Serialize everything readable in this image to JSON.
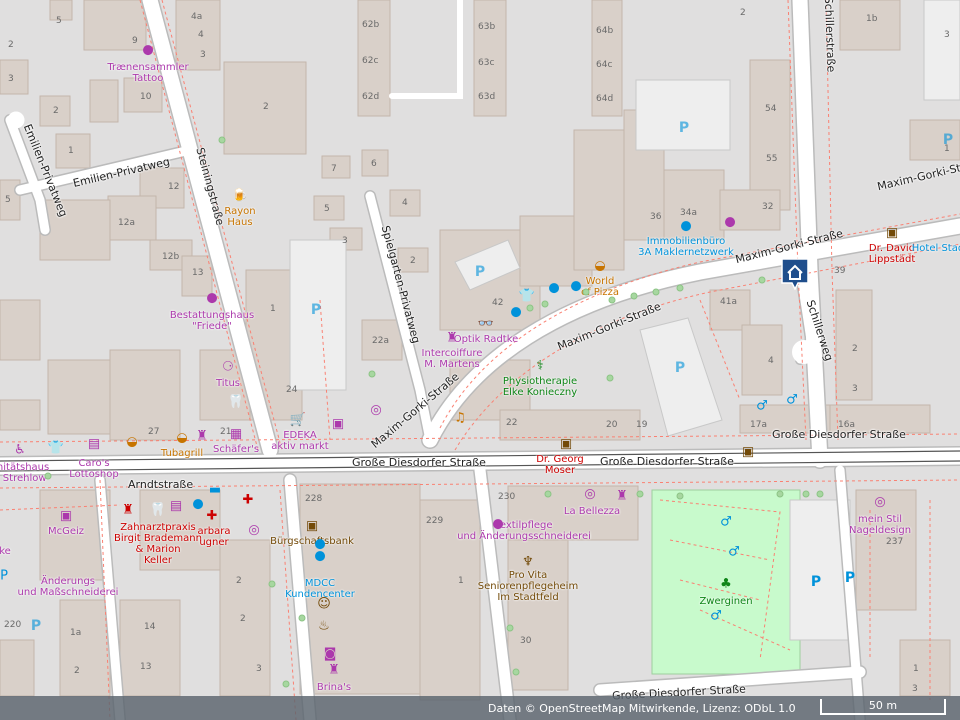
{
  "attribution": "Daten © OpenStreetMap Mitwirkende, Lizenz: ODbL 1.0",
  "scale_label": "50 m",
  "marker_icon": "home-icon",
  "streets": {
    "grosse_diesdorfer_1": "Große Diesdorfer Straße",
    "grosse_diesdorfer_2": "Große Diesdorfer Straße",
    "grosse_diesdorfer_3": "Große Diesdorfer Straße",
    "grosse_diesdorfer_4": "Große Diesdorfer Straße",
    "maxim_1": "Maxim-Gorki-Straße",
    "maxim_2": "Maxim-Gorki-Straße",
    "maxim_3": "Maxim-Gorki-Straße",
    "maxim_4": "Maxim-Gorki-Straße",
    "steiningstrasse": "Steiningstraße",
    "spielgarten": "Spielgarten-Privatweg",
    "emilien_h": "Emilien-Privatweg",
    "emilien_v": "Emilien-Privatweg",
    "schillerstrasse": "Schillerstraße",
    "schillerweg": "Schillerweg",
    "arndtstrasse": "Arndtstraße",
    "bottom_street": "Große Diesdorfer Straße"
  },
  "pois": {
    "tattoo": "Trænensammler\nTattoo",
    "rayon": "Rayon\nHaus",
    "bestattung": "Bestattungshaus\n\"Friede\"",
    "titus": "Titus",
    "edeka": "EDEKA\naktiv markt",
    "schafers": "Schäfer's",
    "tubagrill": "Tubagrill",
    "caros": "Caro's\nLottoshop",
    "sanitaet": "anitätshaus\ne Strehlow",
    "optik": "Optik Radtke",
    "intercoiffure": "Intercoiffure\nM. Martens",
    "physio": "Physiotherapie\nElke Konieczny",
    "world_pizza": "World\nof Pizza",
    "immobilien": "Immobilienbüro\n3A Maklernetzwerk",
    "lippstadt": "Dr. David\nLippstädt",
    "hotel": "Hotel Stad",
    "moser": "Dr. Georg\nMoser",
    "bellezza": "La Bellezza",
    "textilpflege": "Textilpflege\nund Änderungsschneiderei",
    "provita": "Pro Vita\nSeniorenpflegeheim\nIm Stadtfeld",
    "zwerginen": "Zwerginen",
    "meinstil": "mein Stil\nNageldesign",
    "mcgeiz": "McGeiz",
    "anderungen": "Änderungs\nund Maßschneiderei",
    "zahnarzt": "Zahnarztpraxis\nBirgit Brademann\n& Marion\nKeller",
    "barbara": "arbara\nugner",
    "burgschaftsbank": "Bürgschaftsbank",
    "mdcc": "MDCC\nKundencenter",
    "brinas": "Brina's",
    "ke": "ke"
  },
  "housenumbers": [
    "4a",
    "4",
    "3",
    "9",
    "10",
    "2",
    "1",
    "2",
    "3",
    "5",
    "12",
    "12a",
    "12b",
    "13",
    "1",
    "24",
    "27",
    "21",
    "7",
    "6",
    "5",
    "4",
    "3",
    "2",
    "22a",
    "42",
    "62b",
    "62c",
    "62d",
    "63b",
    "63c",
    "63d",
    "64b",
    "64c",
    "64d",
    "36",
    "34a",
    "32",
    "54",
    "55",
    "1b",
    "39",
    "41a",
    "4",
    "2",
    "3",
    "17a",
    "16a",
    "22",
    "20",
    "19",
    "230",
    "229",
    "228",
    "1",
    "30",
    "237",
    "14",
    "13",
    "3",
    "2",
    "220",
    "1a",
    "2",
    "2",
    "3",
    "1",
    "1",
    "3",
    "2",
    "2",
    "5"
  ],
  "colors": {
    "background": "#f2efe9",
    "building": "#d9d0c9",
    "road_white": "#ffffff",
    "road_casing": "#bbbbbb",
    "footway": "#fa8072",
    "park": "#c8facc",
    "parking": "#eeeeee",
    "marker": "#1f4e8c"
  }
}
